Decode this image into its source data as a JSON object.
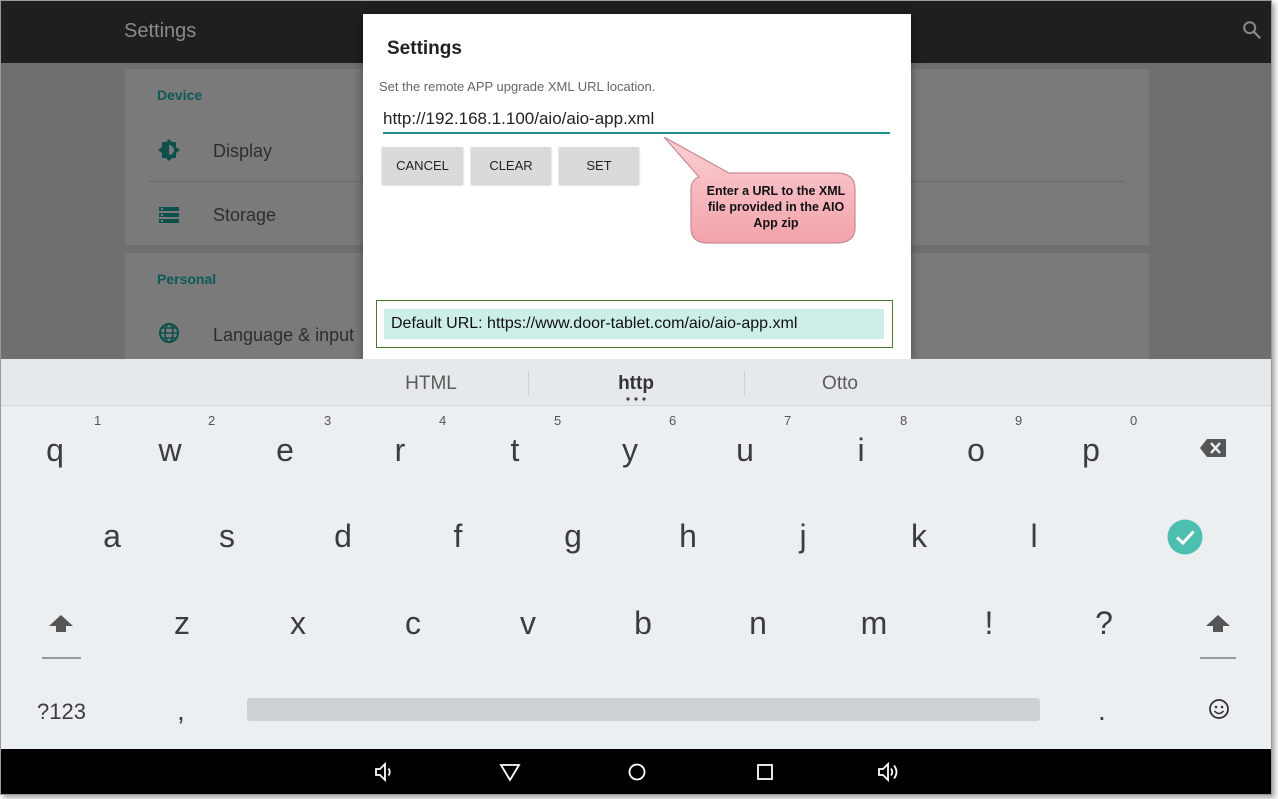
{
  "app_bar": {
    "title": "Settings",
    "search_icon": "search-icon"
  },
  "settings_list": {
    "device_section": "Device",
    "personal_section": "Personal",
    "items": [
      {
        "label": "Display",
        "icon": "brightness-icon"
      },
      {
        "label": "Storage",
        "icon": "storage-icon"
      },
      {
        "label": "Language & input",
        "icon": "globe-icon"
      }
    ]
  },
  "dialog": {
    "title": "Settings",
    "message": "Set the remote APP upgrade XML URL location.",
    "url_value": "http://192.168.1.100/aio/aio-app.xml",
    "cancel_label": "CANCEL",
    "clear_label": "CLEAR",
    "set_label": "SET",
    "default_url_text": "Default URL: https://www.door-tablet.com/aio/aio-app.xml"
  },
  "callout": {
    "text": "Enter a URL to the XML file provided in the AIO App zip"
  },
  "keyboard": {
    "suggestions": [
      "HTML",
      "http",
      "Otto"
    ],
    "row1": [
      "q",
      "w",
      "e",
      "r",
      "t",
      "y",
      "u",
      "i",
      "o",
      "p"
    ],
    "row1_hints": [
      "1",
      "2",
      "3",
      "4",
      "5",
      "6",
      "7",
      "8",
      "9",
      "0"
    ],
    "row2": [
      "a",
      "s",
      "d",
      "f",
      "g",
      "h",
      "j",
      "k",
      "l"
    ],
    "row3": [
      "z",
      "x",
      "c",
      "v",
      "b",
      "n",
      "m",
      "!",
      "?"
    ],
    "symbols_label": "?123",
    "comma_label": ",",
    "period_label": "."
  },
  "colors": {
    "accent": "#1e8f86",
    "enter_key": "#4dbfb0",
    "callout_fill": "#f5b4bb"
  }
}
